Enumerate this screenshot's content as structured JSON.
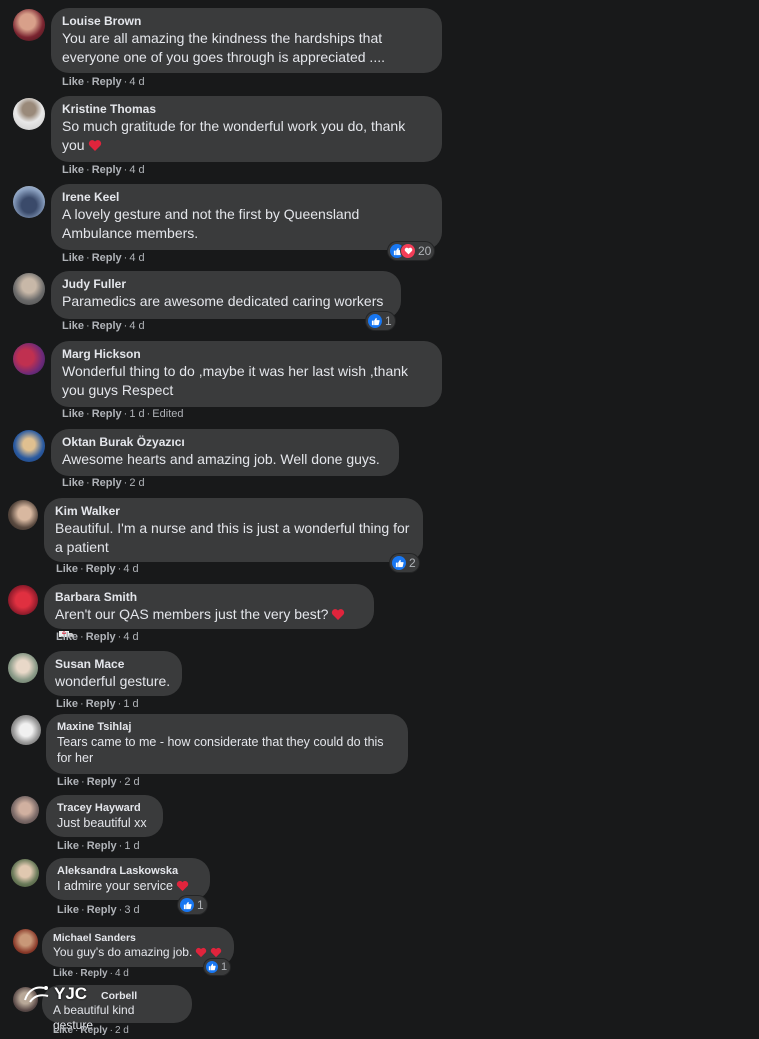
{
  "actions": {
    "like": "Like",
    "reply": "Reply",
    "edited": "Edited"
  },
  "colors": {
    "background": "#18191a",
    "bubble": "#3a3b3c",
    "like_blue": "#1877f2",
    "love_red": "#f33e58"
  },
  "comments": [
    {
      "author": "Louise Brown",
      "text": "You are all amazing the kindness the hardships that everyone one of you goes through is appreciated ....",
      "time": "4 d"
    },
    {
      "author": "Kristine Thomas",
      "text": "So much gratitude for the wonderful work you do, thank you",
      "emoji": "heart",
      "time": "4 d"
    },
    {
      "author": "Irene Keel",
      "text": "A lovely gesture and not the first by Queensland Ambulance members.",
      "time": "4 d",
      "reactions": {
        "icons": [
          "like-icon",
          "love-icon"
        ],
        "count": "20"
      }
    },
    {
      "author": "Judy Fuller",
      "text": "Paramedics are awesome dedicated caring workers",
      "time": "4 d",
      "reactions": {
        "icons": [
          "like-icon"
        ],
        "count": "1"
      }
    },
    {
      "author": "Marg Hickson",
      "text": "Wonderful thing to do ,maybe it was her last wish ,thank you guys Respect",
      "time": "1 d",
      "edited": true
    },
    {
      "author": "Oktan Burak Özyazıcı",
      "text": "Awesome hearts and amazing job. Well done guys.",
      "time": "2 d"
    },
    {
      "author": "Kim Walker",
      "text": "Beautiful. I'm a nurse and this is just a wonderful thing for a patient",
      "time": "4 d",
      "reactions": {
        "icons": [
          "like-icon"
        ],
        "count": "2"
      }
    },
    {
      "author": "Barbara Smith",
      "text": "Aren't our QAS members just the very best?",
      "emoji": "heart-ambulance",
      "time": "4 d"
    },
    {
      "author": "Susan Mace",
      "text": "wonderful gesture.",
      "time": "1 d"
    },
    {
      "author": "Maxine Tsihlaj",
      "text": "Tears came to me - how considerate that they could do this for her",
      "time": "2 d"
    },
    {
      "author": "Tracey Hayward",
      "text": "Just beautiful xx",
      "time": "1 d"
    },
    {
      "author": "Aleksandra Laskowska",
      "text": "I admire your service",
      "emoji": "heart",
      "time": "3 d",
      "reactions": {
        "icons": [
          "like-icon"
        ],
        "count": "1"
      }
    },
    {
      "author": "Michael Sanders",
      "text": "You guy's do amazing job.",
      "emoji": "two-hearts",
      "time": "4 d",
      "reactions": {
        "icons": [
          "like-icon"
        ],
        "count": "1"
      }
    },
    {
      "author": "Corbell",
      "text": "A beautiful kind gesture.",
      "time": "2 d"
    }
  ],
  "watermark": {
    "logo": "YJC"
  }
}
